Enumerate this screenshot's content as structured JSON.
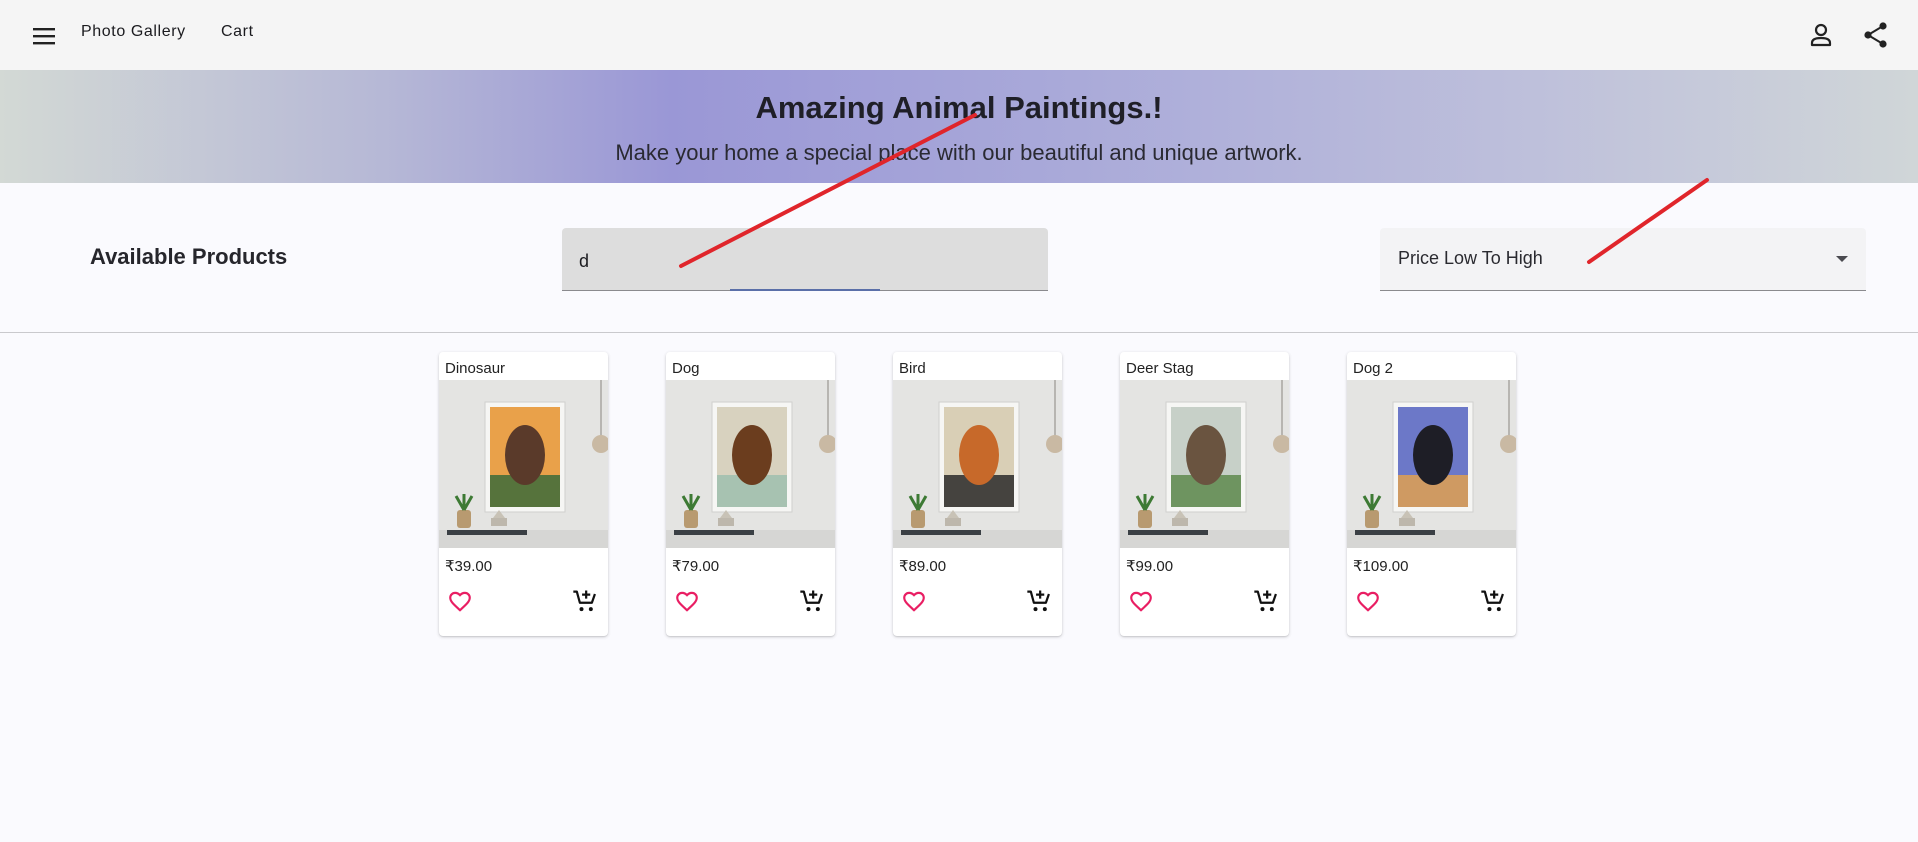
{
  "toolbar": {
    "menu_icon": "menu-icon",
    "links": [
      "Photo Gallery",
      "Cart"
    ],
    "account_icon": "account-icon",
    "share_icon": "share-icon"
  },
  "banner": {
    "title": "Amazing Animal Paintings.!",
    "subtitle": "Make your home a special place with our beautiful and unique artwork."
  },
  "products_section": {
    "title": "Available Products",
    "search": {
      "value": "d",
      "placeholder": ""
    },
    "sort": {
      "selected": "Price Low To High"
    }
  },
  "products": [
    {
      "name": "Dinosaur",
      "price": "₹39.00",
      "art": {
        "sky": "#e9a14a",
        "subject": "#5a3a2a",
        "accent": "#3c6b3a"
      }
    },
    {
      "name": "Dog",
      "price": "₹79.00",
      "art": {
        "sky": "#d8d2bf",
        "subject": "#6b3d1e",
        "accent": "#9fbfae"
      }
    },
    {
      "name": "Bird",
      "price": "₹89.00",
      "art": {
        "sky": "#d9cfb6",
        "subject": "#c7692a",
        "accent": "#2a2a2a"
      }
    },
    {
      "name": "Deer Stag",
      "price": "₹99.00",
      "art": {
        "sky": "#c7d0c8",
        "subject": "#6a5440",
        "accent": "#5e8a4d"
      }
    },
    {
      "name": "Dog 2",
      "price": "₹109.00",
      "art": {
        "sky": "#6c78c8",
        "subject": "#1e1e26",
        "accent": "#e0a050"
      }
    }
  ],
  "colors": {
    "favorite": "#e91e63",
    "annotation": "#e0252b"
  }
}
